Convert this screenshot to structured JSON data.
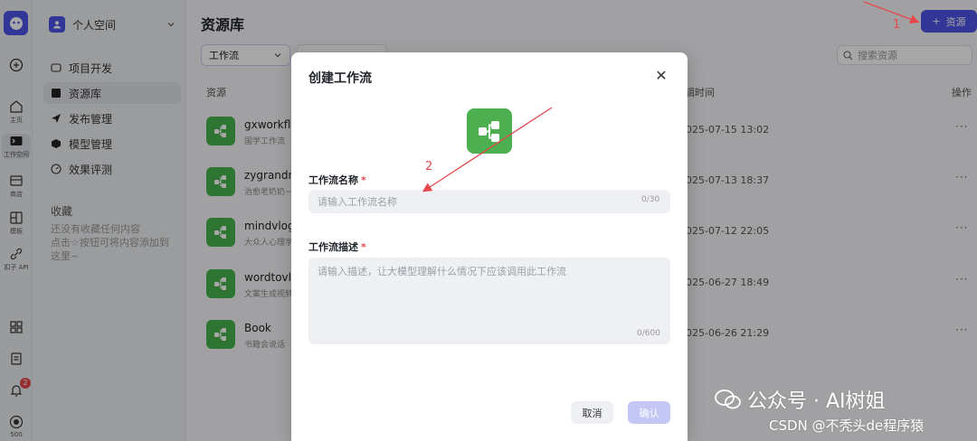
{
  "rail": {
    "items": [
      {
        "label": "主页"
      },
      {
        "label": "工作空间"
      },
      {
        "label": "商店"
      },
      {
        "label": "模板"
      },
      {
        "label": "扣子 API"
      }
    ],
    "notification_count": "2",
    "bottom_label": "500"
  },
  "sidebar": {
    "space_name": "个人空间",
    "items": [
      {
        "label": "项目开发"
      },
      {
        "label": "资源库"
      },
      {
        "label": "发布管理"
      },
      {
        "label": "模型管理"
      },
      {
        "label": "效果评测"
      }
    ],
    "favorites_title": "收藏",
    "favorites_empty_text": "还没有收藏任何内容\n点击☆按钮可将内容添加到这里~"
  },
  "main": {
    "title": "资源库",
    "add_button_label": "资源",
    "filter_type": "工作流",
    "search_placeholder": "搜索资源",
    "columns": {
      "resource": "资源",
      "edit_time": "编辑时间",
      "actions": "操作"
    },
    "rows": [
      {
        "name": "gxworkflow",
        "desc": "国学工作流",
        "time": "2025-07-15 13:02"
      },
      {
        "name": "zygrandma",
        "desc": "治愈老奶奶~",
        "time": "2025-07-13 18:37"
      },
      {
        "name": "mindvlog",
        "desc": "大众人心理学",
        "time": "2025-07-12 22:05"
      },
      {
        "name": "wordtovlog",
        "desc": "文案生成视频",
        "time": "2025-06-27 18:49"
      },
      {
        "name": "Book",
        "desc": "书籍会说话",
        "time": "2025-06-26 21:29"
      }
    ],
    "more_glyph": "···"
  },
  "modal": {
    "title": "创建工作流",
    "name_label": "工作流名称",
    "name_placeholder": "请输入工作流名称",
    "name_counter": "0/30",
    "desc_label": "工作流描述",
    "desc_placeholder": "请输入描述，让大模型理解什么情况下应该调用此工作流",
    "desc_counter": "0/600",
    "required_mark": "*",
    "cancel_label": "取消",
    "confirm_label": "确认",
    "close_glyph": "✕"
  },
  "annotations": {
    "step1": "1",
    "step2": "2"
  },
  "watermark": {
    "line1": "公众号 · AI树姐",
    "line2": "CSDN @不秃头de程序猿"
  },
  "colors": {
    "accent": "#4d53e8",
    "workflow_green": "#4caf50",
    "annotation_red": "#e5484d"
  }
}
